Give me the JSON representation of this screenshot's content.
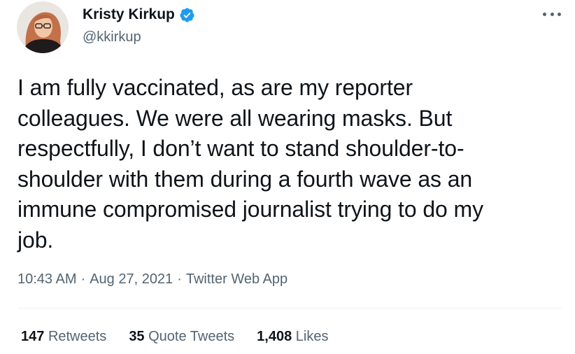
{
  "author": {
    "display_name": "Kristy Kirkup",
    "handle": "@kkirkup",
    "verified": true,
    "avatar_icon": "profile-photo"
  },
  "tweet": {
    "text": "I am fully vaccinated, as are my reporter\ncolleagues. We were all wearing masks. But\nrespectfully, I don’t want to stand shoulder-to-\nshoulder with them during a fourth wave as an\nimmune compromised journalist trying to do my\njob."
  },
  "meta": {
    "time": "10:43 AM",
    "separator": "·",
    "date": "Aug 27, 2021",
    "source": "Twitter Web App"
  },
  "stats": {
    "retweets_count": "147",
    "retweets_label": "Retweets",
    "quotes_count": "35",
    "quotes_label": "Quote Tweets",
    "likes_count": "1,408",
    "likes_label": "Likes"
  },
  "colors": {
    "text": "#0f1419",
    "secondary": "#536471",
    "verified": "#1d9bf0",
    "divider": "#eff3f4"
  },
  "icons": {
    "verified": "verified-badge-icon",
    "more": "more-options-icon"
  }
}
